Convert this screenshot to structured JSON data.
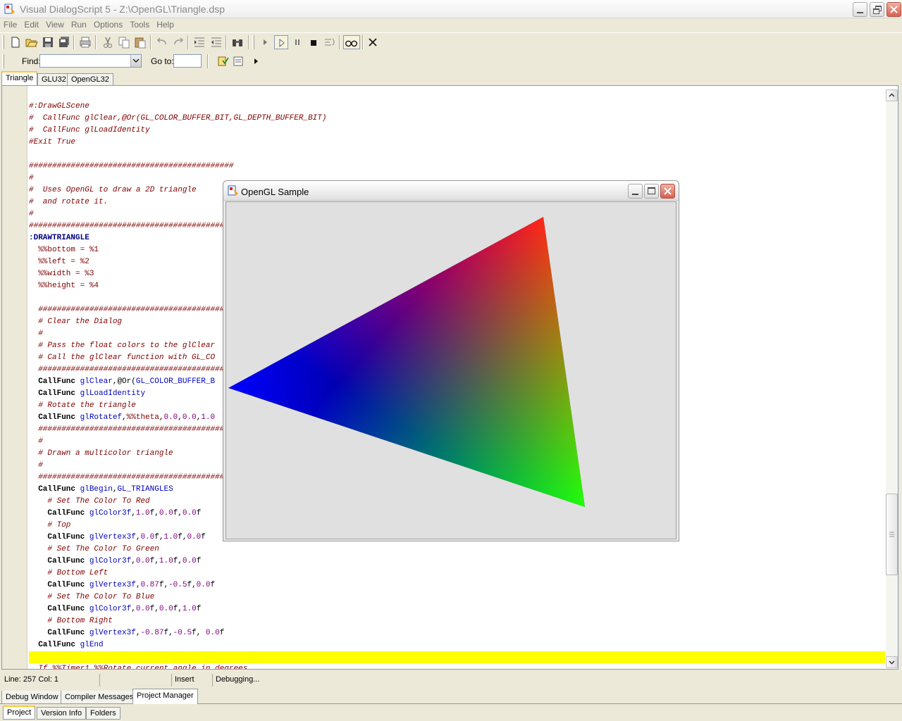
{
  "window": {
    "title": "Visual DialogScript 5 - Z:\\OpenGL\\Triangle.dsp"
  },
  "menu": [
    "File",
    "Edit",
    "View",
    "Run",
    "Options",
    "Tools",
    "Help"
  ],
  "toolbar2": {
    "find_label": "Find:",
    "find_value": "",
    "goto_label": "Go to:",
    "goto_value": ""
  },
  "editor_tabs": [
    "Triangle",
    "GLU32",
    "OpenGL32"
  ],
  "code_lines": [
    [],
    [
      {
        "t": "#:DrawGLScene",
        "c": "c-com"
      }
    ],
    [
      {
        "t": "#  CallFunc glClear,@Or(GL_COLOR_BUFFER_BIT,GL_DEPTH_BUFFER_BIT)",
        "c": "c-com"
      }
    ],
    [
      {
        "t": "#  CallFunc glLoadIdentity",
        "c": "c-com"
      }
    ],
    [
      {
        "t": "#Exit True",
        "c": "c-com"
      }
    ],
    [],
    [
      {
        "t": "############################################",
        "c": "c-com"
      }
    ],
    [
      {
        "t": "#",
        "c": "c-com"
      }
    ],
    [
      {
        "t": "#  Uses OpenGL to draw a 2D triangle",
        "c": "c-com"
      }
    ],
    [
      {
        "t": "#  and rotate it.",
        "c": "c-com"
      }
    ],
    [
      {
        "t": "#",
        "c": "c-com"
      }
    ],
    [
      {
        "t": "############################################",
        "c": "c-com"
      }
    ],
    [
      {
        "t": ":DRAWTRIANGLE",
        "c": "c-kw"
      }
    ],
    [
      {
        "t": "  %%bottom = %1",
        "c": "c-var"
      }
    ],
    [
      {
        "t": "  %%left = %2",
        "c": "c-var"
      }
    ],
    [
      {
        "t": "  %%width = %3",
        "c": "c-var"
      }
    ],
    [
      {
        "t": "  %%height = %4",
        "c": "c-var"
      }
    ],
    [],
    [
      {
        "t": "  ##########################################",
        "c": "c-com"
      }
    ],
    [
      {
        "t": "  # Clear the Dialog",
        "c": "c-com"
      }
    ],
    [
      {
        "t": "  #",
        "c": "c-com"
      }
    ],
    [
      {
        "t": "  # Pass the float colors to the glClear",
        "c": "c-com"
      }
    ],
    [
      {
        "t": "  # Call the glClear function with GL_CO",
        "c": "c-com"
      }
    ],
    [
      {
        "t": "  ##########################################",
        "c": "c-com"
      }
    ],
    [
      {
        "t": "  CallFunc ",
        "c": "c-def"
      },
      {
        "t": "glClear",
        "c": "c-fn"
      },
      {
        "t": ",@Or(",
        "c": ""
      },
      {
        "t": "GL_COLOR_BUFFER_B",
        "c": "c-fn"
      }
    ],
    [
      {
        "t": "  CallFunc ",
        "c": "c-def"
      },
      {
        "t": "glLoadIdentity",
        "c": "c-fn"
      }
    ],
    [
      {
        "t": "  # Rotate the triangle",
        "c": "c-com"
      }
    ],
    [
      {
        "t": "  CallFunc ",
        "c": "c-def"
      },
      {
        "t": "glRotatef",
        "c": "c-fn"
      },
      {
        "t": ",",
        "c": ""
      },
      {
        "t": "%%theta",
        "c": "c-var"
      },
      {
        "t": ",",
        "c": ""
      },
      {
        "t": "0.0",
        "c": "c-num"
      },
      {
        "t": ",",
        "c": ""
      },
      {
        "t": "0.0",
        "c": "c-num"
      },
      {
        "t": ",",
        "c": ""
      },
      {
        "t": "1.0",
        "c": "c-num"
      }
    ],
    [
      {
        "t": "  ##########################################",
        "c": "c-com"
      }
    ],
    [
      {
        "t": "  #",
        "c": "c-com"
      }
    ],
    [
      {
        "t": "  # Drawn a multicolor triangle",
        "c": "c-com"
      }
    ],
    [
      {
        "t": "  #",
        "c": "c-com"
      }
    ],
    [
      {
        "t": "  ##########################################",
        "c": "c-com"
      }
    ],
    [
      {
        "t": "  CallFunc ",
        "c": "c-def"
      },
      {
        "t": "glBegin",
        "c": "c-fn"
      },
      {
        "t": ",",
        "c": ""
      },
      {
        "t": "GL_TRIANGLES",
        "c": "c-fn"
      }
    ],
    [
      {
        "t": "    # Set The Color To Red",
        "c": "c-com"
      }
    ],
    [
      {
        "t": "    CallFunc ",
        "c": "c-def"
      },
      {
        "t": "glColor3f",
        "c": "c-fn"
      },
      {
        "t": ",",
        "c": ""
      },
      {
        "t": "1.0",
        "c": "c-num"
      },
      {
        "t": "f,",
        "c": ""
      },
      {
        "t": "0.0",
        "c": "c-num"
      },
      {
        "t": "f,",
        "c": ""
      },
      {
        "t": "0.0",
        "c": "c-num"
      },
      {
        "t": "f",
        "c": ""
      }
    ],
    [
      {
        "t": "    # Top",
        "c": "c-com"
      }
    ],
    [
      {
        "t": "    CallFunc ",
        "c": "c-def"
      },
      {
        "t": "glVertex3f",
        "c": "c-fn"
      },
      {
        "t": ",",
        "c": ""
      },
      {
        "t": "0.0",
        "c": "c-num"
      },
      {
        "t": "f,",
        "c": ""
      },
      {
        "t": "1.0",
        "c": "c-num"
      },
      {
        "t": "f,",
        "c": ""
      },
      {
        "t": "0.0",
        "c": "c-num"
      },
      {
        "t": "f",
        "c": ""
      }
    ],
    [
      {
        "t": "    # Set The Color To Green",
        "c": "c-com"
      }
    ],
    [
      {
        "t": "    CallFunc ",
        "c": "c-def"
      },
      {
        "t": "glColor3f",
        "c": "c-fn"
      },
      {
        "t": ",",
        "c": ""
      },
      {
        "t": "0.0",
        "c": "c-num"
      },
      {
        "t": "f,",
        "c": ""
      },
      {
        "t": "1.0",
        "c": "c-num"
      },
      {
        "t": "f,",
        "c": ""
      },
      {
        "t": "0.0",
        "c": "c-num"
      },
      {
        "t": "f",
        "c": ""
      }
    ],
    [
      {
        "t": "    # Bottom Left",
        "c": "c-com"
      }
    ],
    [
      {
        "t": "    CallFunc ",
        "c": "c-def"
      },
      {
        "t": "glVertex3f",
        "c": "c-fn"
      },
      {
        "t": ",",
        "c": ""
      },
      {
        "t": "0.87",
        "c": "c-num"
      },
      {
        "t": "f,",
        "c": ""
      },
      {
        "t": "-0.5",
        "c": "c-num"
      },
      {
        "t": "f,",
        "c": ""
      },
      {
        "t": "0.0",
        "c": "c-num"
      },
      {
        "t": "f",
        "c": ""
      }
    ],
    [
      {
        "t": "    # Set The Color To Blue",
        "c": "c-com"
      }
    ],
    [
      {
        "t": "    CallFunc ",
        "c": "c-def"
      },
      {
        "t": "glColor3f",
        "c": "c-fn"
      },
      {
        "t": ",",
        "c": ""
      },
      {
        "t": "0.0",
        "c": "c-num"
      },
      {
        "t": "f,",
        "c": ""
      },
      {
        "t": "0.0",
        "c": "c-num"
      },
      {
        "t": "f,",
        "c": ""
      },
      {
        "t": "1.0",
        "c": "c-num"
      },
      {
        "t": "f",
        "c": ""
      }
    ],
    [
      {
        "t": "    # Bottom Right",
        "c": "c-com"
      }
    ],
    [
      {
        "t": "    CallFunc ",
        "c": "c-def"
      },
      {
        "t": "glVertex3f",
        "c": "c-fn"
      },
      {
        "t": ",",
        "c": ""
      },
      {
        "t": "-0.87",
        "c": "c-num"
      },
      {
        "t": "f,",
        "c": ""
      },
      {
        "t": "-0.5",
        "c": "c-num"
      },
      {
        "t": "f, ",
        "c": ""
      },
      {
        "t": "0.0",
        "c": "c-num"
      },
      {
        "t": "f",
        "c": ""
      }
    ],
    [
      {
        "t": "  CallFunc ",
        "c": "c-def"
      },
      {
        "t": "glEnd",
        "c": "c-fn"
      }
    ],
    [
      {
        "t": "",
        "c": "",
        "highlight": true
      }
    ],
    [
      {
        "t": "  If %%Timer1 %%Rotate current angle in degrees",
        "c": "c-com"
      }
    ]
  ],
  "gl_window": {
    "title": "OpenGL Sample",
    "vertex_colors": [
      "#ff0000",
      "#00ff00",
      "#0000ff"
    ]
  },
  "statusbar": {
    "position": "Line: 257  Col: 1",
    "mode": "Insert",
    "state": "Debugging..."
  },
  "bottom_tabs": [
    "Debug Window",
    "Compiler Messages",
    "Project Manager"
  ],
  "project_tabs": [
    "Project",
    "Version Info",
    "Folders"
  ],
  "colors": {
    "highlight_line": "#ffff00",
    "comment": "#800000",
    "function": "#0000c0",
    "number": "#800080"
  }
}
